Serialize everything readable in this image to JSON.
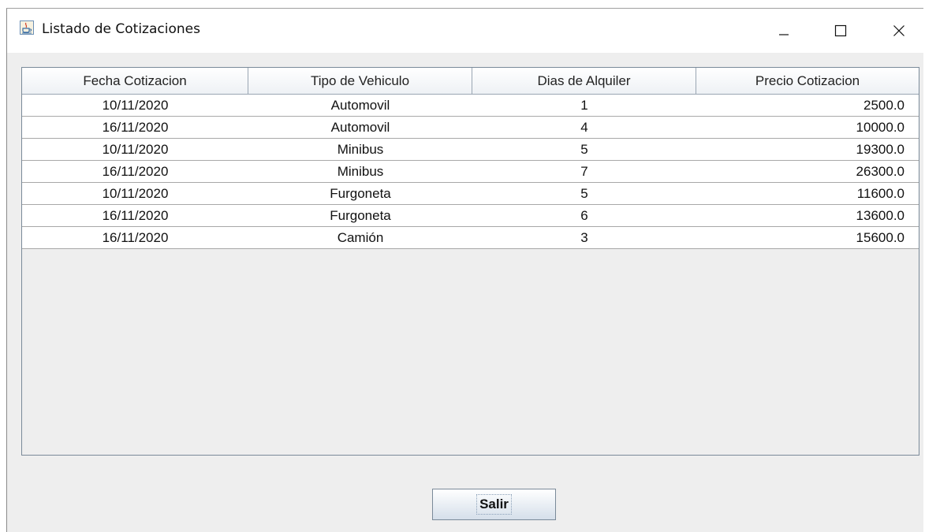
{
  "window": {
    "title": "Listado de Cotizaciones",
    "icon": "java-cup-icon"
  },
  "controls": {
    "minimize": "minimize-icon",
    "maximize": "maximize-icon",
    "close": "close-icon"
  },
  "table": {
    "columns": [
      "Fecha Cotizacion",
      "Tipo de Vehiculo",
      "Dias de Alquiler",
      "Precio Cotizacion"
    ],
    "rows": [
      [
        "10/11/2020",
        "Automovil",
        "1",
        "2500.0"
      ],
      [
        "16/11/2020",
        "Automovil",
        "4",
        "10000.0"
      ],
      [
        "10/11/2020",
        "Minibus",
        "5",
        "19300.0"
      ],
      [
        "16/11/2020",
        "Minibus",
        "7",
        "26300.0"
      ],
      [
        "10/11/2020",
        "Furgoneta",
        "5",
        "11600.0"
      ],
      [
        "16/11/2020",
        "Furgoneta",
        "6",
        "13600.0"
      ],
      [
        "16/11/2020",
        "Camión",
        "3",
        "15600.0"
      ]
    ]
  },
  "buttons": {
    "exit_label": "Salir"
  }
}
